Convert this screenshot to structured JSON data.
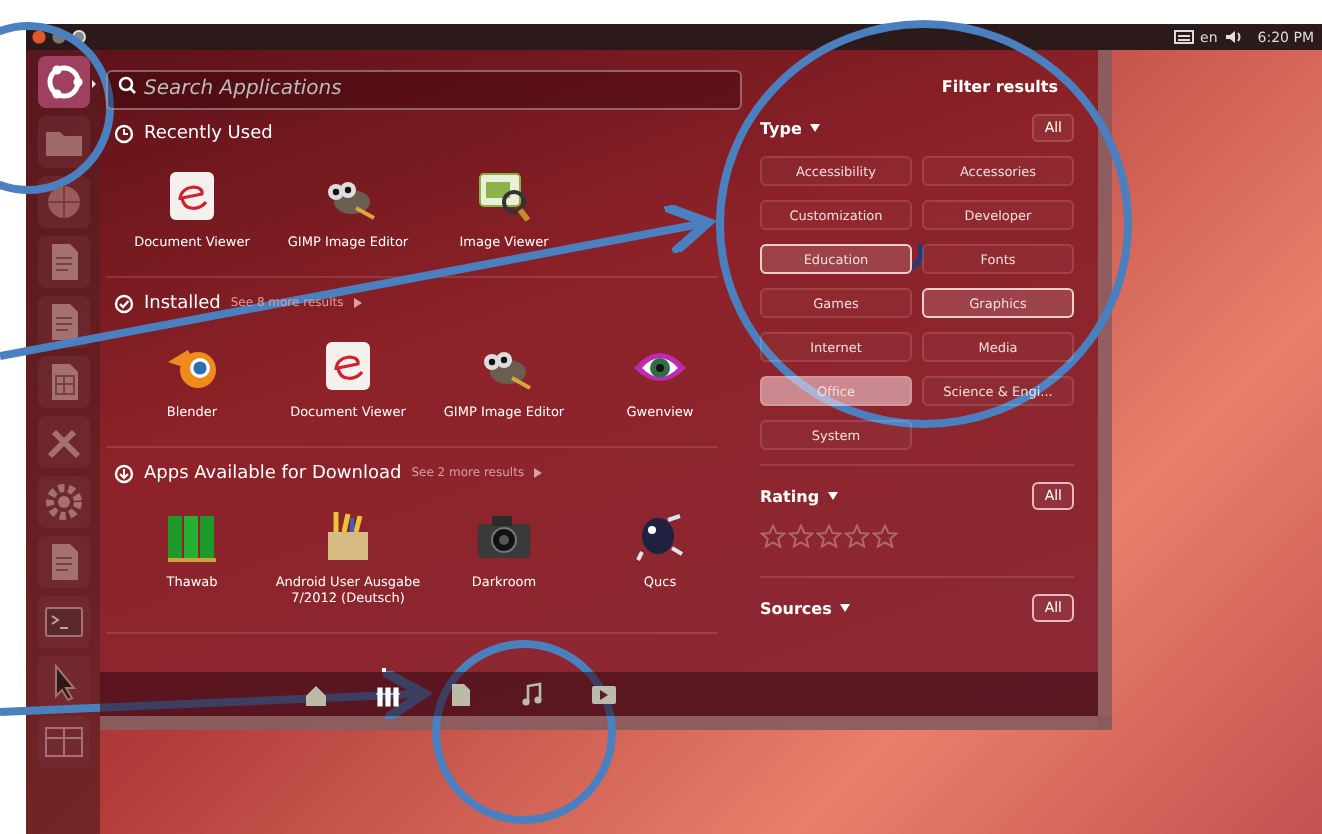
{
  "top_panel": {
    "language": "en",
    "time": "6:20 PM"
  },
  "launcher": {
    "items": [
      {
        "kind": "dash",
        "selected": true
      },
      {
        "kind": "folder",
        "selected": false
      },
      {
        "kind": "browser",
        "selected": false
      },
      {
        "kind": "document",
        "selected": false
      },
      {
        "kind": "document",
        "selected": false
      },
      {
        "kind": "spreadsheet",
        "selected": false
      },
      {
        "kind": "tools",
        "selected": false
      },
      {
        "kind": "settings",
        "selected": false
      },
      {
        "kind": "document",
        "selected": false
      },
      {
        "kind": "terminal",
        "selected": false
      },
      {
        "kind": "pointer",
        "selected": false
      },
      {
        "kind": "workspaces",
        "selected": false
      }
    ]
  },
  "search": {
    "placeholder": "Search Applications"
  },
  "sections": [
    {
      "kind": "recent",
      "title": "Recently Used",
      "apps": [
        {
          "name": "Document Viewer",
          "kind": "document"
        },
        {
          "name": "GIMP Image Editor",
          "kind": "mascot"
        },
        {
          "name": "Image Viewer",
          "kind": "image"
        }
      ]
    },
    {
      "kind": "installed",
      "title": "Installed",
      "more": "See 8 more results",
      "apps": [
        {
          "name": "Blender",
          "kind": "orbit"
        },
        {
          "name": "Document Viewer",
          "kind": "document"
        },
        {
          "name": "GIMP Image Editor",
          "kind": "mascot"
        },
        {
          "name": "Gwenview",
          "kind": "eye"
        }
      ]
    },
    {
      "kind": "download",
      "title": "Apps Available for Download",
      "more": "See 2 more results",
      "apps": [
        {
          "name": "Thawab",
          "kind": "books"
        },
        {
          "name": "Android User Ausgabe 7/2012 (Deutsch)",
          "kind": "pencils"
        },
        {
          "name": "Darkroom",
          "kind": "camera"
        },
        {
          "name": "Qucs",
          "kind": "creature"
        }
      ]
    }
  ],
  "filters": {
    "title": "Filter results",
    "groups": [
      {
        "kind": "options",
        "title": "Type",
        "all": "All",
        "all_selected": false,
        "options": [
          {
            "label": "Accessibility",
            "selected": false,
            "highlighted": false
          },
          {
            "label": "Accessories",
            "selected": false,
            "highlighted": false
          },
          {
            "label": "Customization",
            "selected": false,
            "highlighted": false
          },
          {
            "label": "Developer",
            "selected": false,
            "highlighted": false
          },
          {
            "label": "Education",
            "selected": true,
            "highlighted": false
          },
          {
            "label": "Fonts",
            "selected": false,
            "highlighted": false
          },
          {
            "label": "Games",
            "selected": false,
            "highlighted": false
          },
          {
            "label": "Graphics",
            "selected": true,
            "highlighted": false
          },
          {
            "label": "Internet",
            "selected": false,
            "highlighted": false
          },
          {
            "label": "Media",
            "selected": false,
            "highlighted": false
          },
          {
            "label": "Office",
            "selected": false,
            "highlighted": true
          },
          {
            "label": "Science & Engi...",
            "selected": false,
            "highlighted": false
          },
          {
            "label": "System",
            "selected": false,
            "highlighted": false
          }
        ]
      },
      {
        "kind": "rating",
        "title": "Rating",
        "all": "All",
        "all_selected": true,
        "stars": 0
      },
      {
        "kind": "plain",
        "title": "Sources",
        "all": "All",
        "all_selected": true
      }
    ]
  },
  "lenses": [
    {
      "kind": "home",
      "selected": false
    },
    {
      "kind": "applications",
      "selected": true
    },
    {
      "kind": "files",
      "selected": false
    },
    {
      "kind": "music",
      "selected": false
    },
    {
      "kind": "video",
      "selected": false
    }
  ]
}
